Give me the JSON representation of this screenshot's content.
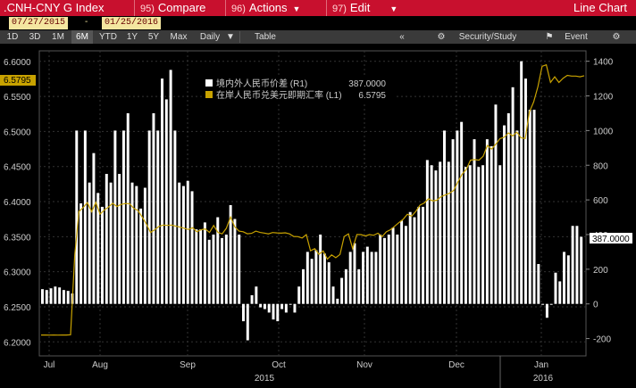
{
  "toolbar": {
    "ticker": ".CNH-CNY G Index",
    "compare": {
      "num": "95)",
      "label": "Compare"
    },
    "actions": {
      "num": "96)",
      "label": "Actions"
    },
    "edit": {
      "num": "97)",
      "label": "Edit"
    },
    "chart_type": "Line Chart"
  },
  "date_range": {
    "start": "07/27/2015",
    "end": "01/25/2016"
  },
  "periods": [
    "1D",
    "3D",
    "1M",
    "6M",
    "YTD",
    "1Y",
    "5Y",
    "Max"
  ],
  "selected_period": "6M",
  "frequency": "Daily",
  "table_label": "Table",
  "security_study": "Security/Study",
  "event": "Event",
  "colors": {
    "bars": "#ffffff",
    "line": "#c8a200",
    "header": "#c8102e"
  },
  "chart_data": {
    "type": "bar",
    "x_tick_labels": [
      "Jul",
      "Aug",
      "Sep",
      "Oct",
      "Nov",
      "Dec",
      "Jan"
    ],
    "x_year_labels": [
      "2015",
      "2016"
    ],
    "legend": [
      {
        "label": "境内外人民币价差 (R1)",
        "value": "387.0000",
        "swatch": "#ffffff"
      },
      {
        "label": "在岸人民币兑美元即期汇率 (L1)",
        "value": "6.5795",
        "swatch": "#c8a200"
      }
    ],
    "left_axis": {
      "ticks": [
        "6.2000",
        "6.2500",
        "6.3000",
        "6.3500",
        "6.4000",
        "6.4500",
        "6.5000",
        "6.5500",
        "6.6000"
      ],
      "ylim": [
        6.18,
        6.615
      ],
      "last_label": "6.5795",
      "last": 6.5795
    },
    "right_axis": {
      "ticks": [
        "-200",
        "0",
        "200",
        "400",
        "600",
        "800",
        "1000",
        "1200",
        "1400"
      ],
      "ylim": [
        -300,
        1460
      ],
      "last_label": "387.0000",
      "last": 387
    },
    "series": [
      {
        "name": "境内外人民币价差 (R1)",
        "type": "bar",
        "values": [
          85,
          80,
          90,
          100,
          95,
          80,
          75,
          60,
          1000,
          580,
          1000,
          700,
          870,
          640,
          560,
          750,
          700,
          1000,
          750,
          1000,
          1100,
          700,
          680,
          550,
          670,
          1000,
          1100,
          1000,
          1300,
          1180,
          1350,
          1000,
          700,
          680,
          710,
          650,
          430,
          430,
          470,
          370,
          400,
          500,
          380,
          400,
          570,
          490,
          400,
          -100,
          -210,
          50,
          100,
          -20,
          -30,
          -50,
          -90,
          -100,
          -30,
          -50,
          0,
          -50,
          100,
          200,
          300,
          260,
          310,
          400,
          290,
          240,
          100,
          30,
          150,
          200,
          300,
          350,
          200,
          300,
          330,
          300,
          300,
          400,
          380,
          400,
          440,
          400,
          480,
          450,
          530,
          500,
          560,
          560,
          830,
          800,
          770,
          820,
          1000,
          820,
          950,
          1000,
          1050,
          790,
          800,
          950,
          790,
          800,
          950,
          910,
          1150,
          800,
          1030,
          1100,
          1250,
          1000,
          1400,
          1300,
          1120,
          1120,
          230,
          0,
          -80,
          0,
          180,
          130,
          300,
          280,
          450,
          450,
          387
        ]
      },
      {
        "name": "在岸人民币兑美元即期汇率 (L1)",
        "type": "line",
        "values": [
          6.2097,
          6.2098,
          6.2096,
          6.2097,
          6.2096,
          6.2097,
          6.2098,
          6.2102,
          6.3244,
          6.3858,
          6.3915,
          6.3987,
          6.3856,
          6.3989,
          6.382,
          6.388,
          6.3921,
          6.3976,
          6.393,
          6.396,
          6.3973,
          6.397,
          6.3905,
          6.3873,
          6.3782,
          6.3681,
          6.356,
          6.36,
          6.3647,
          6.3666,
          6.3661,
          6.3666,
          6.365,
          6.3637,
          6.362,
          6.3602,
          6.3628,
          6.357,
          6.3598,
          6.361,
          6.356,
          6.366,
          6.356,
          6.354,
          6.362,
          6.378,
          6.364,
          6.358,
          6.357,
          6.3541,
          6.3547,
          6.358,
          6.356,
          6.3551,
          6.354,
          6.3559,
          6.3554,
          6.355,
          6.3555,
          6.354,
          6.3503,
          6.35,
          6.3481,
          6.353,
          6.33,
          6.3329,
          6.3249,
          6.3297,
          6.318,
          6.324,
          6.32,
          6.3246,
          6.35,
          6.354,
          6.333,
          6.353,
          6.353,
          6.351,
          6.353,
          6.352,
          6.355,
          6.35,
          6.357,
          6.36,
          6.365,
          6.37,
          6.3747,
          6.382,
          6.3792,
          6.386,
          6.395,
          6.398,
          6.404,
          6.401,
          6.402,
          6.407,
          6.4094,
          6.412,
          6.4159,
          6.428,
          6.439,
          6.446,
          6.459,
          6.46,
          6.459,
          6.4646,
          6.48,
          6.4748,
          6.4818,
          6.4898,
          6.4918,
          6.498,
          6.4936,
          6.499,
          6.491,
          6.49,
          6.528,
          6.542,
          6.564,
          6.593,
          6.595,
          6.57,
          6.578,
          6.57,
          6.576,
          6.58,
          6.579,
          6.579,
          6.578,
          6.5795
        ]
      }
    ]
  }
}
